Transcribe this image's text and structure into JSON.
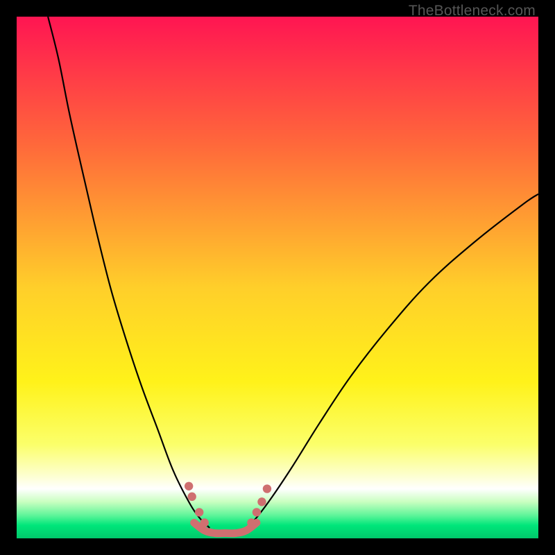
{
  "watermark": "TheBottleneck.com",
  "colors": {
    "background_frame": "#000000",
    "marker": "#cf6f70",
    "curve": "#000000",
    "gradient_stops": [
      {
        "offset": 0.0,
        "color": "#ff1552"
      },
      {
        "offset": 0.25,
        "color": "#ff6a3a"
      },
      {
        "offset": 0.52,
        "color": "#ffcf2a"
      },
      {
        "offset": 0.7,
        "color": "#fff21a"
      },
      {
        "offset": 0.82,
        "color": "#fbff6a"
      },
      {
        "offset": 0.88,
        "color": "#fdffd0"
      },
      {
        "offset": 0.905,
        "color": "#ffffff"
      },
      {
        "offset": 0.93,
        "color": "#c9ffc0"
      },
      {
        "offset": 0.955,
        "color": "#63f59b"
      },
      {
        "offset": 0.975,
        "color": "#00e67a"
      },
      {
        "offset": 1.0,
        "color": "#00c86b"
      }
    ]
  },
  "chart_data": {
    "type": "line",
    "title": "",
    "xlabel": "",
    "ylabel": "",
    "xlim": [
      0,
      100
    ],
    "ylim": [
      0,
      100
    ],
    "grid": false,
    "legend": false,
    "note": "Axes are unitless; values estimated from pixel positions. y=0 is the bottom of the plot area, y=100 the top.",
    "series": [
      {
        "name": "left-curve",
        "x": [
          6,
          8,
          10,
          12,
          15,
          18,
          21,
          24,
          27,
          30,
          33,
          35,
          37
        ],
        "y": [
          100,
          92,
          82,
          73,
          60,
          48,
          38,
          29,
          21,
          13,
          7,
          4,
          2
        ]
      },
      {
        "name": "right-curve",
        "x": [
          44,
          46,
          49,
          53,
          58,
          64,
          71,
          79,
          88,
          97,
          100
        ],
        "y": [
          2,
          4,
          8,
          14,
          22,
          31,
          40,
          49,
          57,
          64,
          66
        ]
      },
      {
        "name": "bottom-marker-band",
        "x": [
          34,
          36,
          38,
          40,
          42,
          44,
          46
        ],
        "y": [
          3,
          1.5,
          1,
          1,
          1,
          1.5,
          3
        ]
      }
    ],
    "marker_dots_left": [
      {
        "x": 33,
        "y": 10
      },
      {
        "x": 33.6,
        "y": 8
      },
      {
        "x": 35,
        "y": 5
      },
      {
        "x": 36,
        "y": 3
      }
    ],
    "marker_dots_right": [
      {
        "x": 45,
        "y": 3
      },
      {
        "x": 46,
        "y": 5
      },
      {
        "x": 47,
        "y": 7
      },
      {
        "x": 48,
        "y": 9.5
      }
    ]
  }
}
